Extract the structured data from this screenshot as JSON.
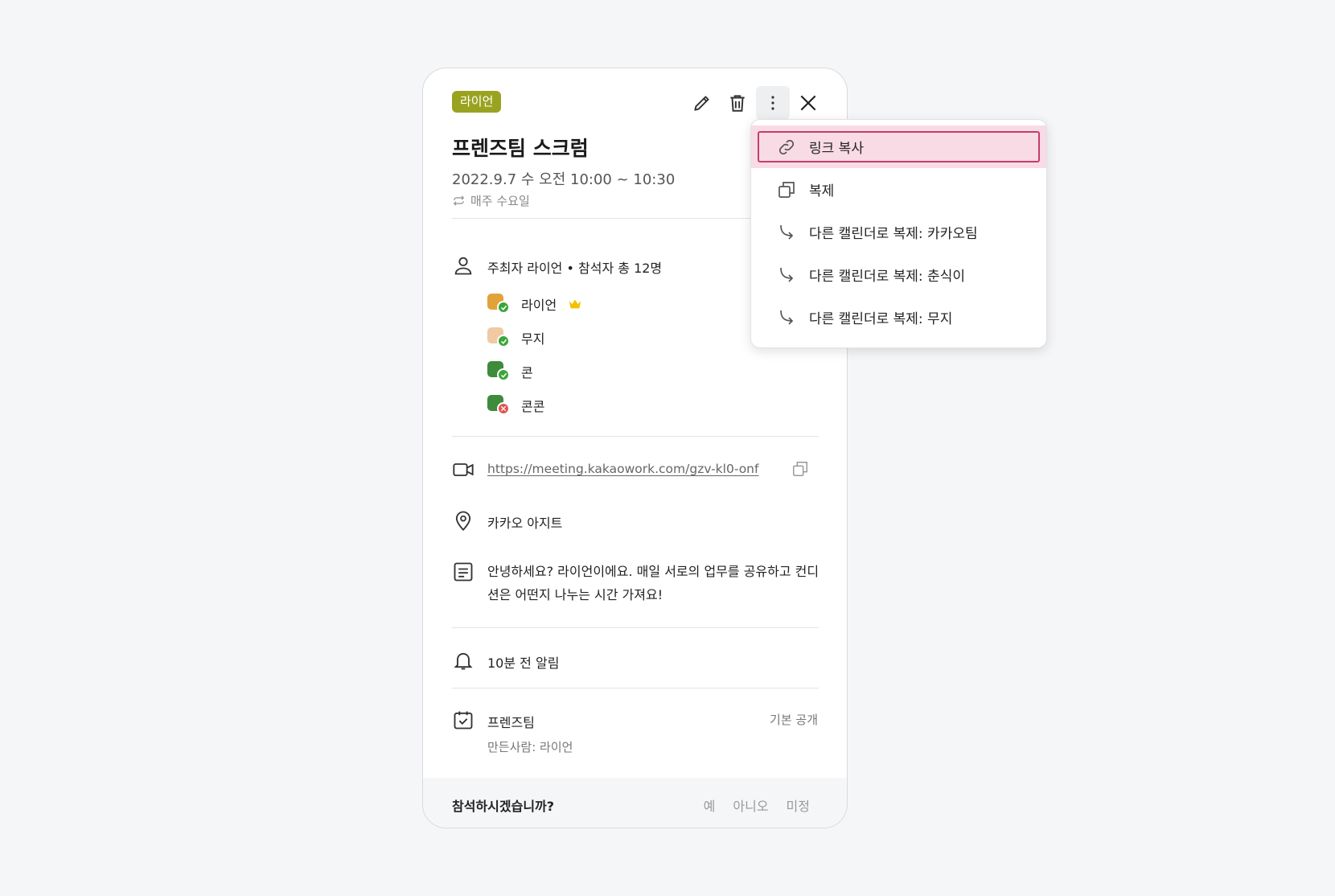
{
  "event": {
    "calendar_badge": "라이언",
    "title": "프렌즈팀 스크럼",
    "datetime": "2022.9.7 수 오전 10:00 ~ 10:30",
    "repeat": "매주 수요일",
    "attendee_summary": "주최자 라이언  •  참석자 총 12명",
    "attendees": [
      {
        "name": "라이언",
        "status": "accepted",
        "organizer": true,
        "avatar_color": "#e2a23a"
      },
      {
        "name": "무지",
        "status": "accepted",
        "organizer": false,
        "avatar_color": "#f1c9a3"
      },
      {
        "name": "콘",
        "status": "accepted",
        "organizer": false,
        "avatar_color": "#3e8b3c"
      },
      {
        "name": "콘콘",
        "status": "declined",
        "organizer": false,
        "avatar_color": "#3e8b3c"
      }
    ],
    "meeting_link": "https://meeting.kakaowork.com/gzv-kl0-onf",
    "location": "카카오 아지트",
    "description": "안녕하세요? 라이언이에요. 매일 서로의 업무를 공유하고 컨디션은 어떤지 나누는 시간 가져요!",
    "reminder": "10분 전 알림",
    "calendar_name": "프렌즈팀",
    "calendar_creator": "만든사람: 라이언",
    "calendar_visibility": "기본 공개",
    "rsvp": {
      "question": "참석하시겠습니까?",
      "yes": "예",
      "no": "아니오",
      "maybe": "미정"
    }
  },
  "menu": {
    "items": [
      {
        "label": "링크 복사",
        "icon": "link-icon",
        "highlighted": true
      },
      {
        "label": "복제",
        "icon": "duplicate-icon",
        "highlighted": false
      },
      {
        "label": "다른 캘린더로 복제: 카카오팀",
        "icon": "arrow-return-icon",
        "highlighted": false
      },
      {
        "label": "다른 캘린더로 복제: 춘식이",
        "icon": "arrow-return-icon",
        "highlighted": false
      },
      {
        "label": "다른 캘린더로 복제: 무지",
        "icon": "arrow-return-icon",
        "highlighted": false
      }
    ]
  },
  "colors": {
    "badge": "#9aa31f",
    "highlight_bg": "#f8dbe5",
    "highlight_border": "#c43d6c",
    "accepted": "#3aa63a",
    "declined": "#e25555",
    "crown": "#f2c200"
  }
}
